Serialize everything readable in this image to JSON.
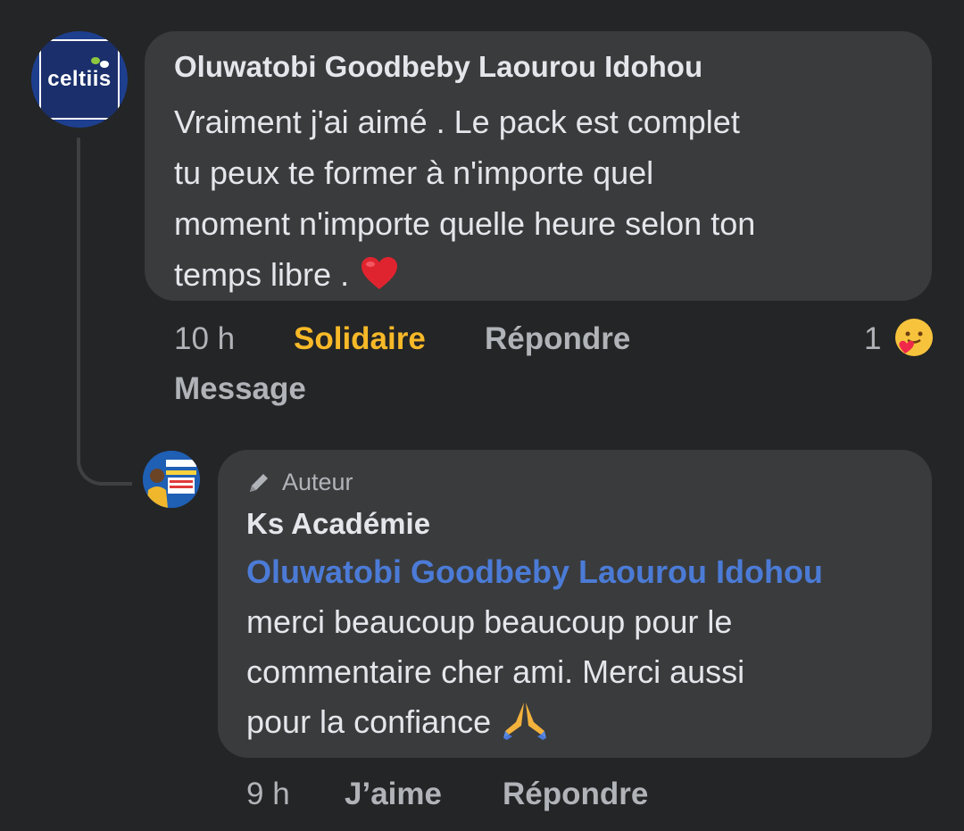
{
  "comment": {
    "author": "Oluwatobi Goodbeby Laourou Idohou",
    "avatar_logo": "celtiis",
    "text": "Vraiment j'ai aimé . Le pack est complet\ntu peux te former à n'importe quel\nmoment n'importe quelle heure selon ton\ntemps libre .",
    "emoji": "heart-icon",
    "time": "10 h",
    "reaction_label": "Solidaire",
    "reply_label": "Répondre",
    "message_label": "Message",
    "reaction_count": "1",
    "reaction_icon": "care-react-icon",
    "reaction_color": "#f7b928"
  },
  "reply": {
    "badge": "Auteur",
    "author": "Ks Académie",
    "mention": "Oluwatobi Goodbeby Laourou Idohou",
    "text": "merci beaucoup beaucoup pour le\ncommentaire cher ami. Merci aussi\npour la confiance",
    "emoji": "praying-hands-icon",
    "time": "9 h",
    "like_label": "J’aime",
    "reply_label": "Répondre",
    "mention_color": "#4b7bd6"
  }
}
